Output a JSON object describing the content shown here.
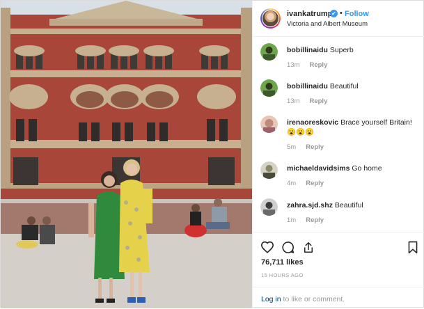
{
  "header": {
    "username": "ivankatrump",
    "verified_mark": "✔",
    "separator": "•",
    "follow_label": "Follow",
    "location": "Victoria and Albert Museum"
  },
  "comments": [
    {
      "user": "bobillinaidu",
      "text": "Superb",
      "time": "13m",
      "reply": "Reply",
      "avatar_color": "#6fa64a"
    },
    {
      "user": "bobillinaidu",
      "text": "Beautiful",
      "time": "13m",
      "reply": "Reply",
      "avatar_color": "#6fa64a"
    },
    {
      "user": "irenaoreskovic",
      "text": "Brace yourself Britain! 😮😮😮",
      "time": "5m",
      "reply": "Reply",
      "avatar_color": "#c08a7a"
    },
    {
      "user": "michaeldavidsims",
      "text": "Go home",
      "time": "4m",
      "reply": "Reply",
      "avatar_color": "#8a8a6a"
    },
    {
      "user": "zahra.sjd.shz",
      "text": "Beautiful",
      "time": "1m",
      "reply": "Reply",
      "avatar_color": "#6a6a6a"
    }
  ],
  "actions": {
    "like_icon": "heart-icon",
    "comment_icon": "comment-icon",
    "share_icon": "share-icon",
    "save_icon": "bookmark-icon"
  },
  "likes": "76,711 likes",
  "posted_ago": "15 HOURS AGO",
  "login": {
    "link": "Log in",
    "rest": " to like or comment."
  },
  "colors": {
    "accent": "#3897f0",
    "muted": "#999999",
    "border": "#efefef"
  }
}
